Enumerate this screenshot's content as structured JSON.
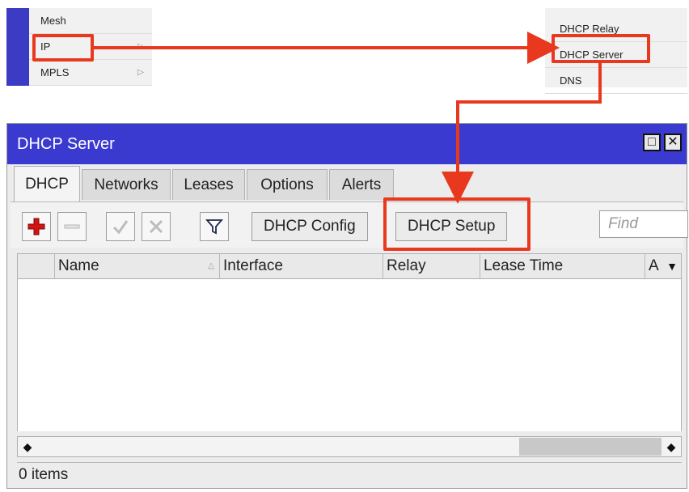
{
  "left_menu": {
    "items": [
      {
        "label": "Mesh"
      },
      {
        "label": "IP"
      },
      {
        "label": "MPLS"
      }
    ]
  },
  "right_menu": {
    "items": [
      {
        "label": "DHCP Relay"
      },
      {
        "label": "DHCP Server"
      },
      {
        "label": "DNS"
      }
    ]
  },
  "window": {
    "title": "DHCP Server",
    "tabs": [
      {
        "label": "DHCP"
      },
      {
        "label": "Networks"
      },
      {
        "label": "Leases"
      },
      {
        "label": "Options"
      },
      {
        "label": "Alerts"
      }
    ],
    "toolbar": {
      "dhcp_config_label": "DHCP Config",
      "dhcp_setup_label": "DHCP Setup",
      "find_placeholder": "Find"
    },
    "table": {
      "columns": [
        "Name",
        "Interface",
        "Relay",
        "Lease Time",
        "A"
      ]
    },
    "status": "0 items"
  },
  "colors": {
    "titlebar": "#3a3ad0",
    "highlight": "#e8391f"
  }
}
